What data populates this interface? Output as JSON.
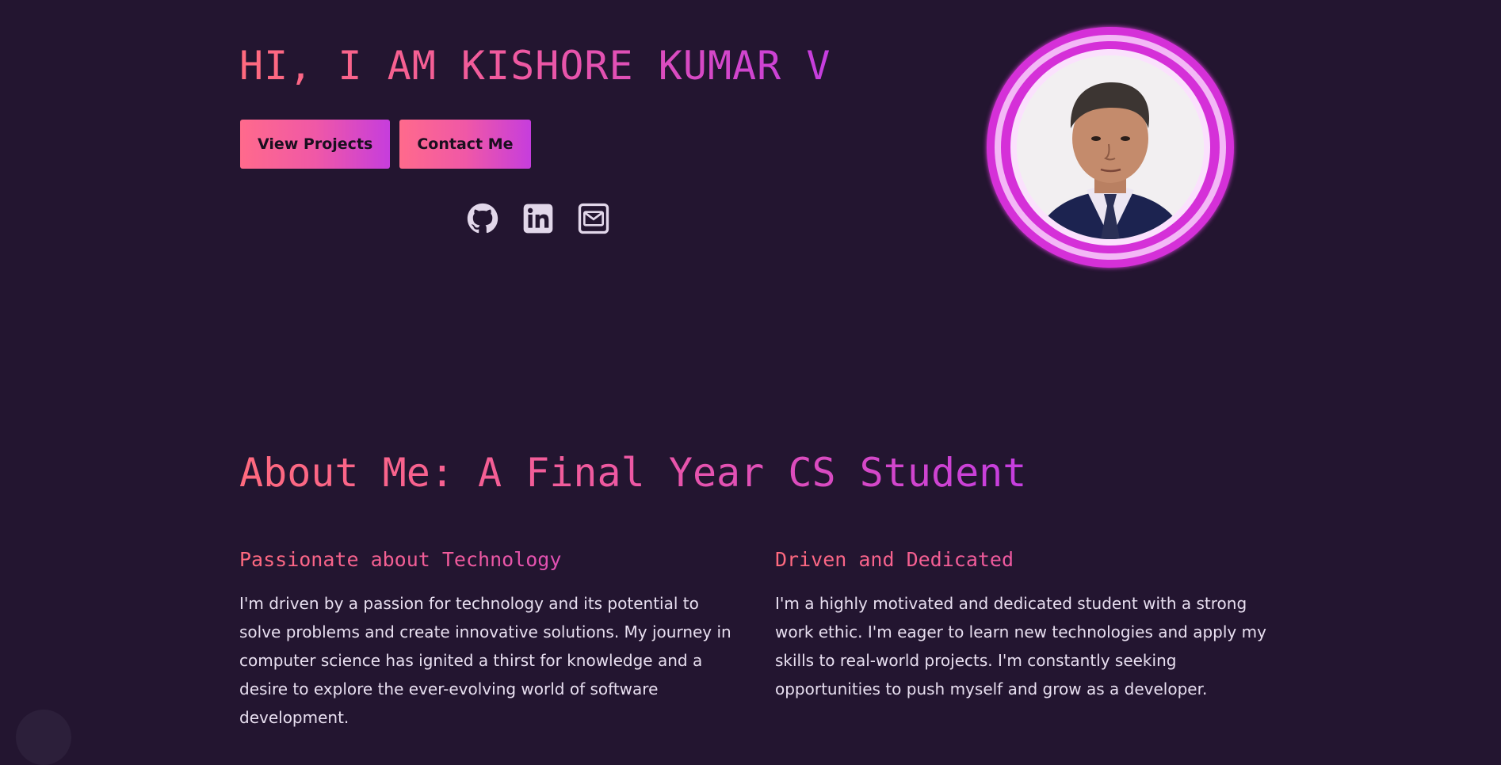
{
  "hero": {
    "title": "HI, I AM KISHORE KUMAR V",
    "buttons": {
      "view_projects": "View Projects",
      "contact_me": "Contact Me"
    },
    "socials": [
      {
        "icon": "github-icon"
      },
      {
        "icon": "linkedin-icon"
      },
      {
        "icon": "mail-icon"
      }
    ]
  },
  "about": {
    "title": "About Me: A Final Year CS Student",
    "columns": [
      {
        "heading": "Passionate about Technology",
        "text": "I'm driven by a passion for technology and its potential to solve problems and create innovative solutions. My journey in computer science has ignited a thirst for knowledge and a desire to explore the ever-evolving world of software development."
      },
      {
        "heading": "Driven and Dedicated",
        "text": "I'm a highly motivated and dedicated student with a strong work ethic. I'm eager to learn new technologies and apply my skills to real-world projects. I'm constantly seeking opportunities to push myself and grow as a developer."
      }
    ]
  },
  "colors": {
    "background": "#231530",
    "gradient_start": "#ff6a7e",
    "gradient_end": "#c53de0",
    "ring": "#d530d8",
    "text": "#e6dbef"
  }
}
